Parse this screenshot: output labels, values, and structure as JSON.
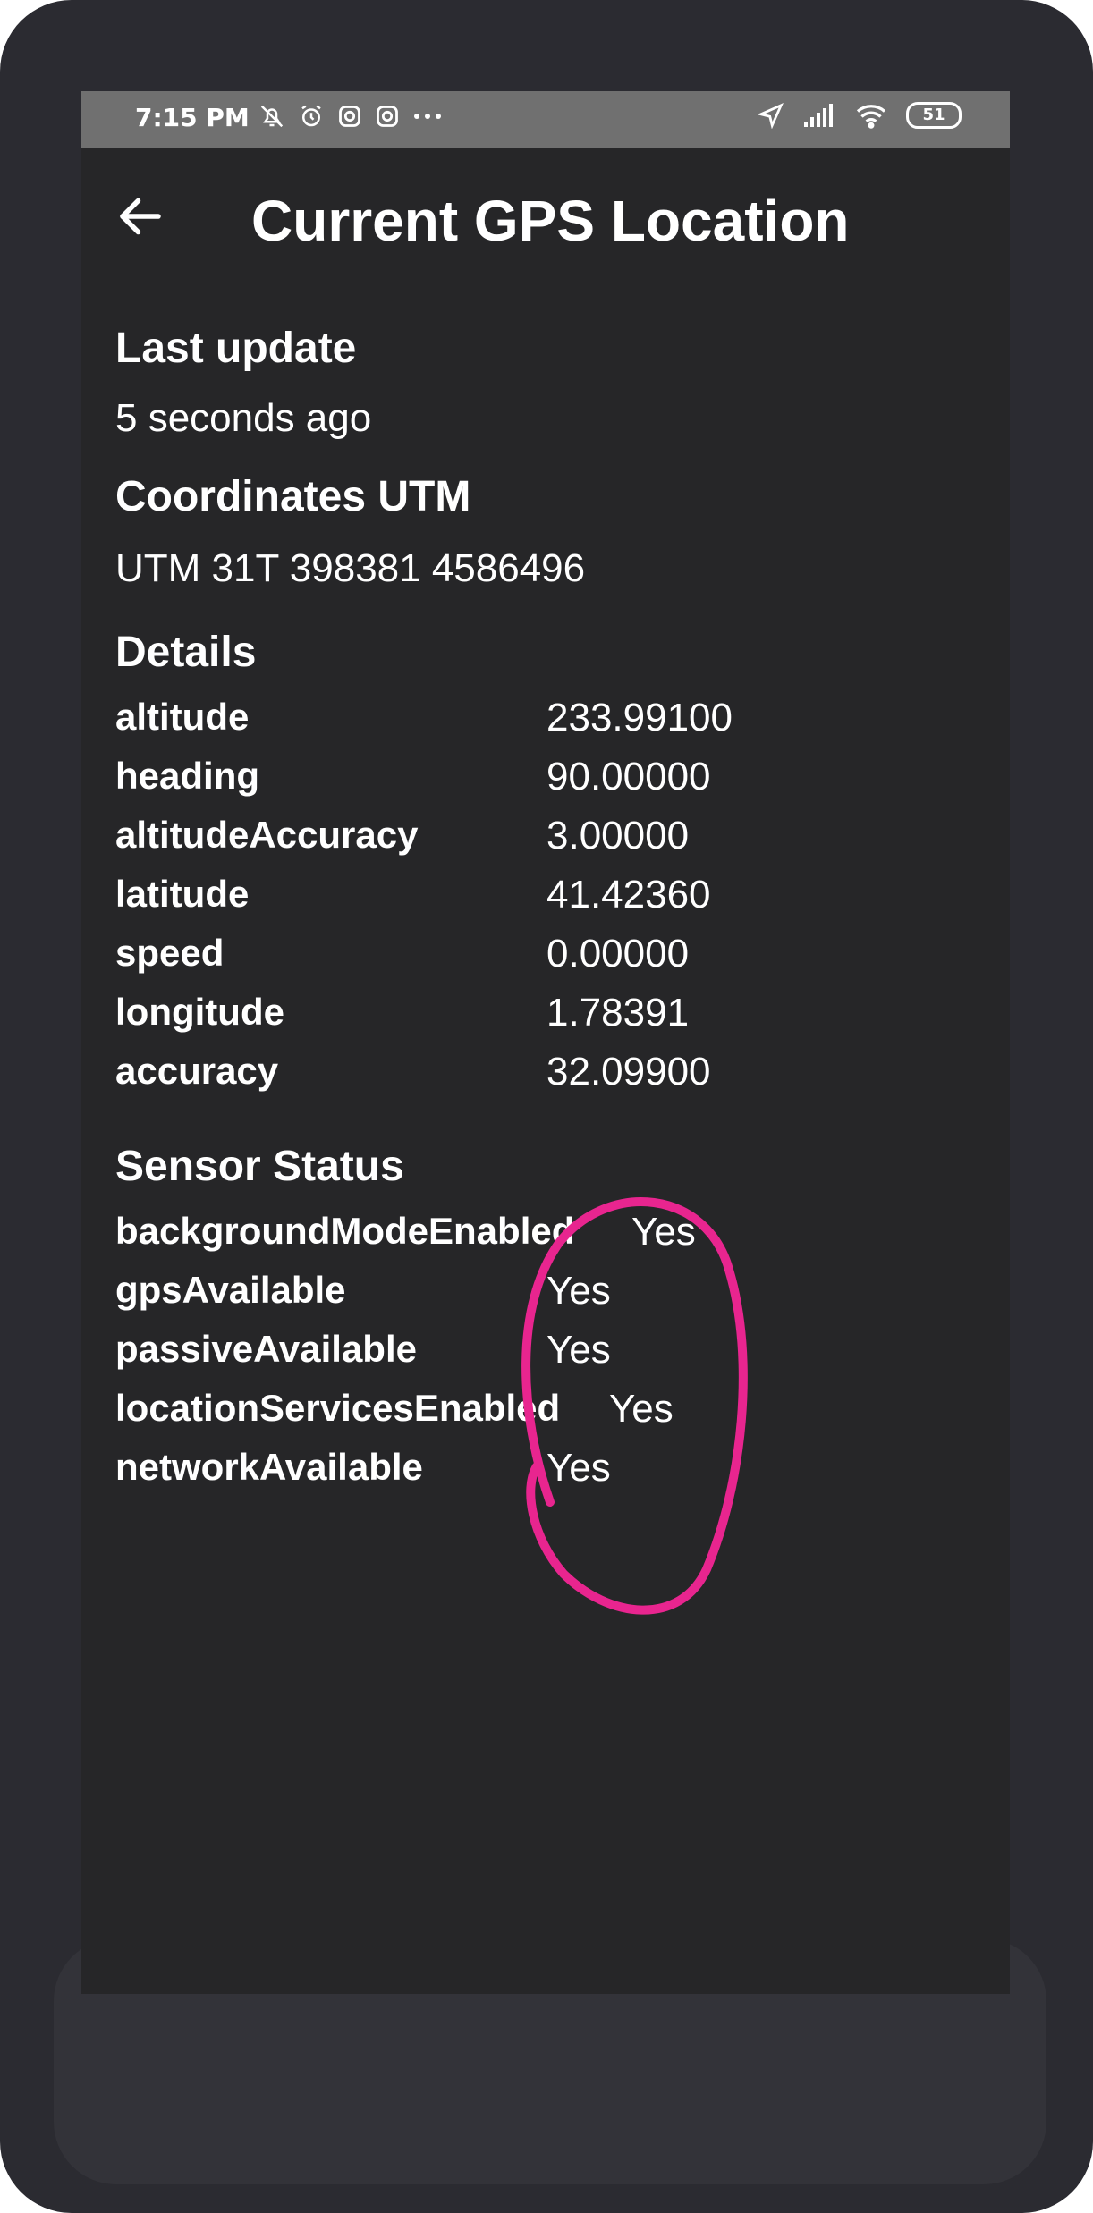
{
  "status_bar": {
    "time": "7:15 PM",
    "left_icons": [
      "bell-off-icon",
      "alarm-icon",
      "instagram-icon",
      "instagram-icon",
      "more-dots-icon"
    ],
    "right_icons": [
      "location-arrow-icon",
      "signal-icon",
      "wifi-icon"
    ],
    "battery": "51"
  },
  "header": {
    "title": "Current GPS Location",
    "back_icon": "back-arrow-icon"
  },
  "last_update": {
    "heading": "Last update",
    "value": "5 seconds ago"
  },
  "coordinates": {
    "heading": "Coordinates UTM",
    "value": "UTM 31T 398381 4586496"
  },
  "details": {
    "heading": "Details",
    "rows": [
      {
        "key": "altitude",
        "value": "233.99100"
      },
      {
        "key": "heading",
        "value": "90.00000"
      },
      {
        "key": "altitudeAccuracy",
        "value": "3.00000"
      },
      {
        "key": "latitude",
        "value": "41.42360"
      },
      {
        "key": "speed",
        "value": "0.00000"
      },
      {
        "key": "longitude",
        "value": "1.78391"
      },
      {
        "key": "accuracy",
        "value": "32.09900"
      }
    ]
  },
  "sensor_status": {
    "heading": "Sensor Status",
    "rows": [
      {
        "key": "backgroundModeEnabled",
        "value": "Yes"
      },
      {
        "key": "gpsAvailable",
        "value": "Yes"
      },
      {
        "key": "passiveAvailable",
        "value": "Yes"
      },
      {
        "key": "locationServicesEnabled",
        "value": "Yes"
      },
      {
        "key": "networkAvailable",
        "value": "Yes"
      }
    ]
  },
  "colors": {
    "screen_bg": "#262628",
    "status_bar_bg": "#707070",
    "device_frame": "#2b2b31",
    "annotation": "#e8258f",
    "text": "#ffffff"
  }
}
